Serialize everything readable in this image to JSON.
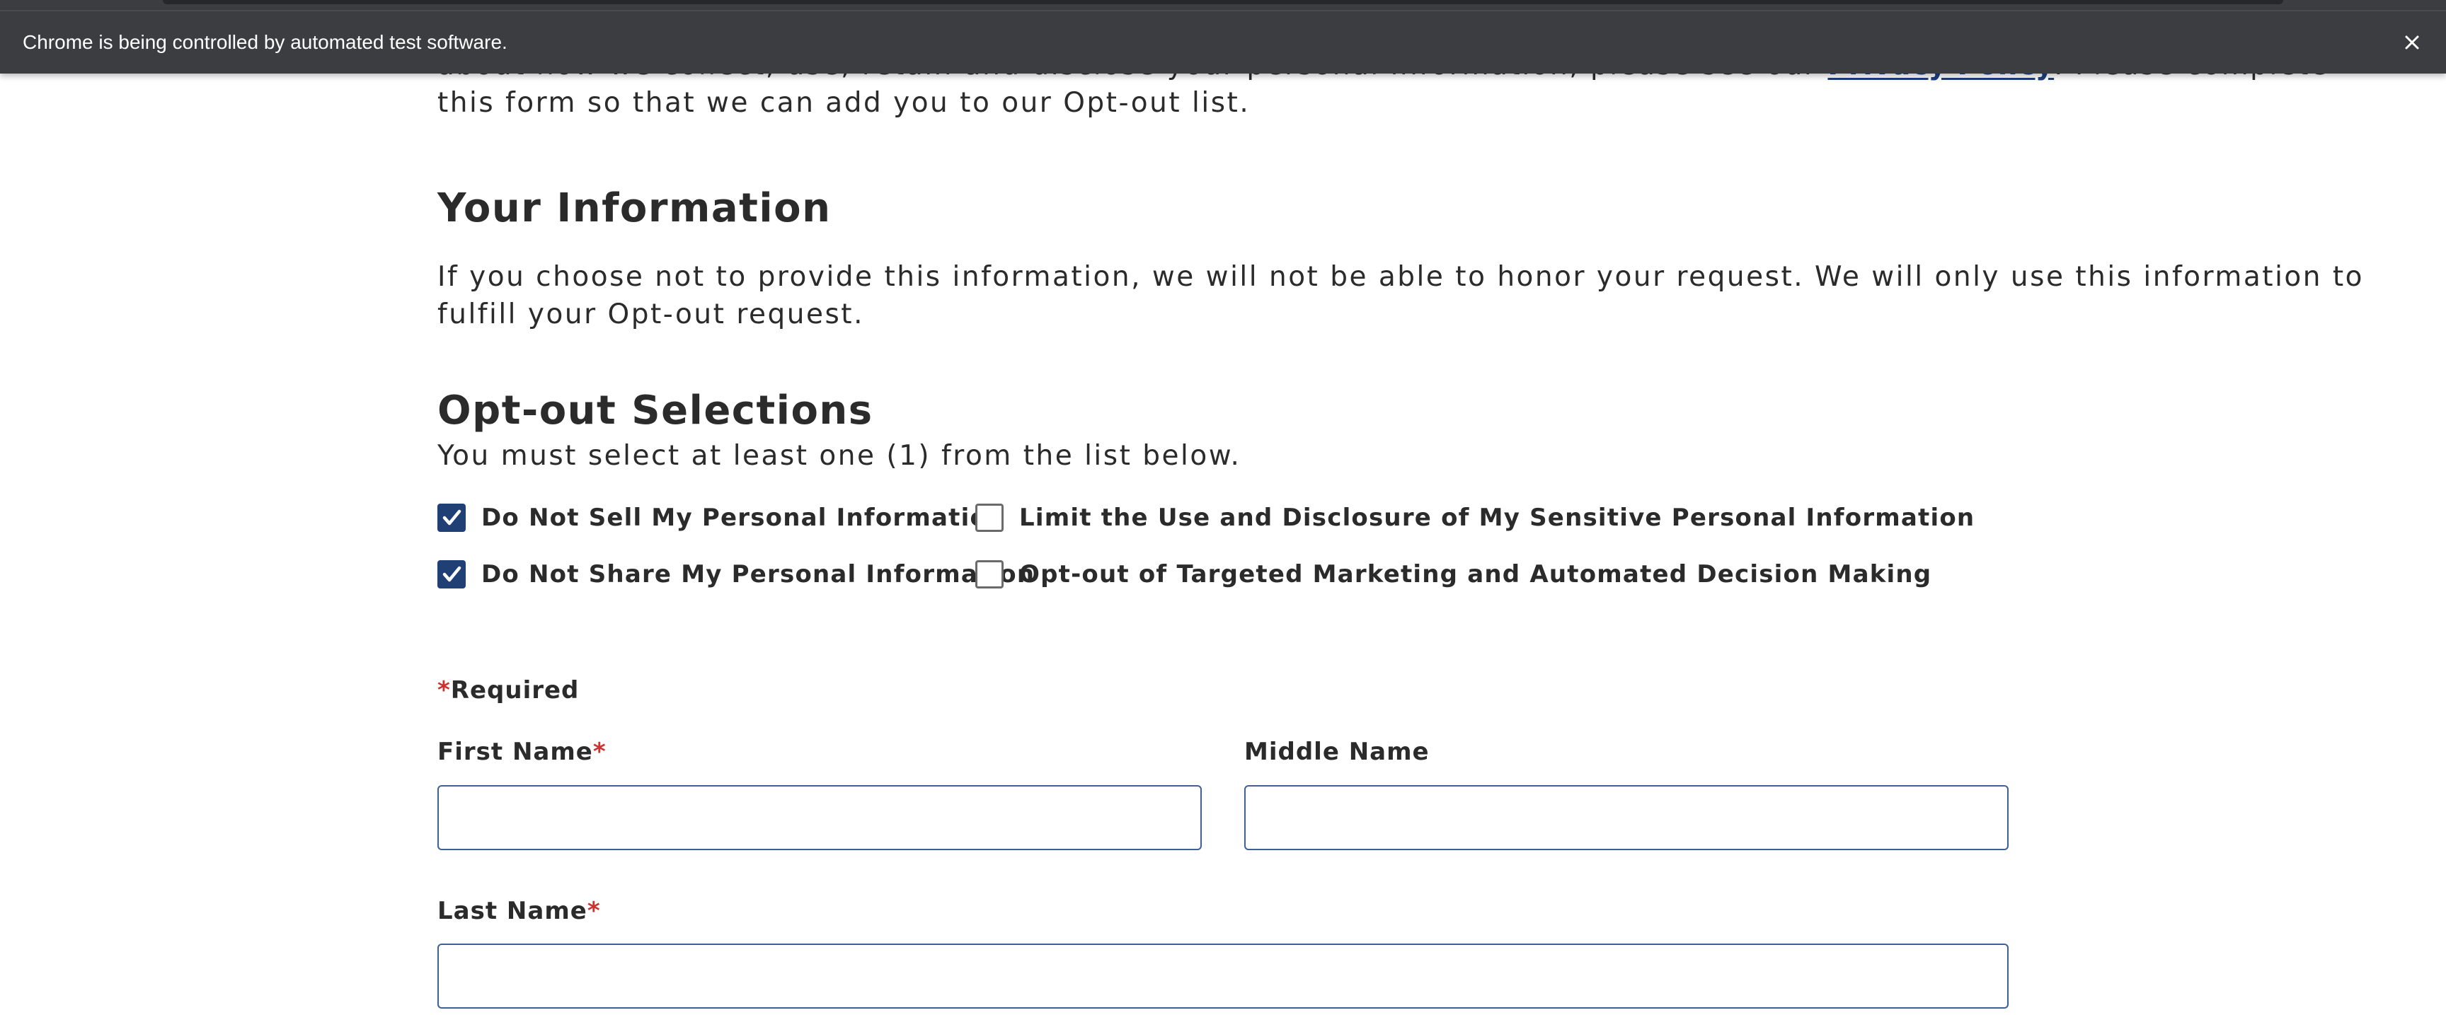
{
  "infobar": {
    "message": "Chrome is being controlled by automated test software.",
    "close_icon": "close-icon"
  },
  "intro": {
    "text_before_link": "about how we collect, use, retain and disclose your personal information, please see our ",
    "link_text": "Privacy Policy",
    "text_after_link": ". Please complete",
    "line2": "this form so that we can add you to our Opt-out list."
  },
  "your_information": {
    "heading": "Your Information",
    "line1": "If you choose not to provide this information, we will not be able to honor your request. We will only use this information to",
    "line2": "fulfill your Opt-out request."
  },
  "opt_out": {
    "heading": "Opt-out Selections",
    "subtitle": "You must select at least one (1) from the list below.",
    "options": [
      {
        "label": "Do Not Sell My Personal Information",
        "checked": true
      },
      {
        "label": "Do Not Share My Personal Information",
        "checked": true
      },
      {
        "label": "Limit the Use and Disclosure of My Sensitive Personal Information",
        "checked": false
      },
      {
        "label": "Opt-out of Targeted Marketing and Automated Decision Making",
        "checked": false
      }
    ]
  },
  "form": {
    "required_asterisk": "*",
    "required_text": "Required",
    "first_name_label": "First Name",
    "first_name_value": "",
    "middle_name_label": "Middle Name",
    "middle_name_value": "",
    "last_name_label": "Last Name",
    "last_name_value": ""
  },
  "colors": {
    "infobar_bg": "#3c3d40",
    "link": "#1c3f7a",
    "checkbox_checked": "#1f3f75",
    "required": "#d0312d",
    "input_border": "#3f5f95"
  }
}
